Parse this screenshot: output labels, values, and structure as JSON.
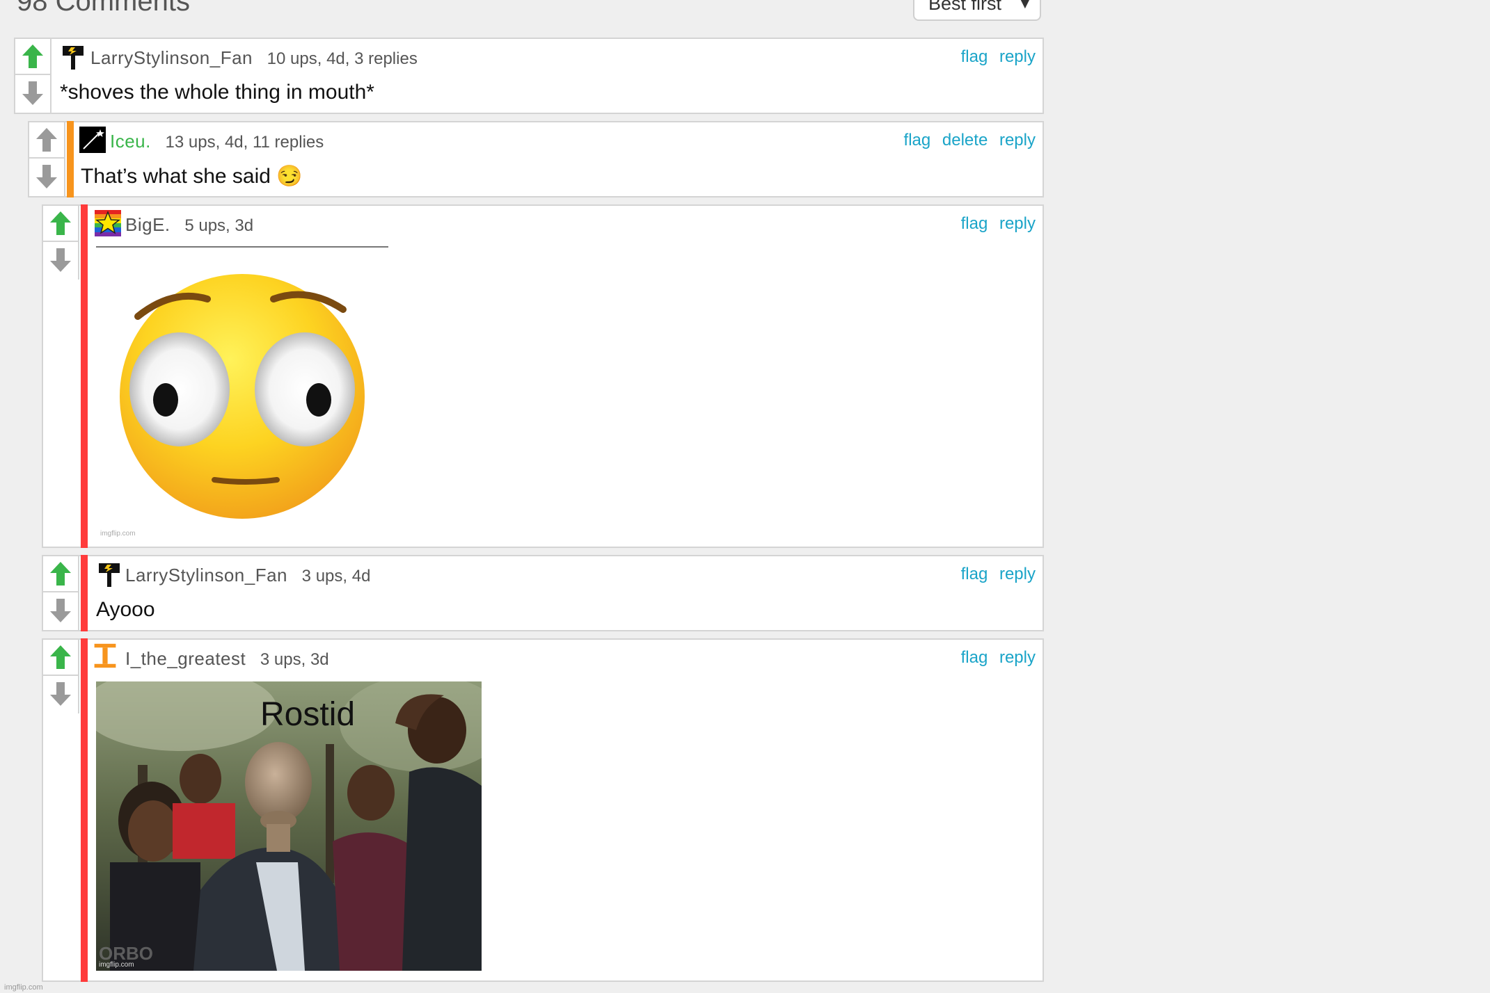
{
  "header": {
    "title": "98 Comments",
    "sort_label": "Best first"
  },
  "comments": [
    {
      "user": "LarryStylinson_Fan",
      "meta": "10 ups, 4d, 3 replies",
      "text": "*shoves the whole thing in mouth*",
      "actions": [
        "flag",
        "reply"
      ]
    },
    {
      "user": "Iceu.",
      "meta": "13 ups, 4d, 11 replies",
      "text": "That’s what she said 😏",
      "actions": [
        "flag",
        "delete",
        "reply"
      ],
      "bar_color": "#f7941d"
    },
    {
      "user": "BigE.",
      "meta": "5 ups, 3d",
      "actions": [
        "flag",
        "reply"
      ],
      "image_watermark": "imgflip.com",
      "bar_color": "#ff3b3b"
    },
    {
      "user": "LarryStylinson_Fan",
      "meta": "3 ups, 4d",
      "text": "Ayooo",
      "actions": [
        "flag",
        "reply"
      ],
      "bar_color": "#ff3b3b"
    },
    {
      "user": "I_the_greatest",
      "meta": "3 ups, 3d",
      "actions": [
        "flag",
        "reply"
      ],
      "image_caption": "Rostid",
      "image_watermark": "imgflip.com",
      "image_logo": "ORBO",
      "bar_color": "#ff3b3b"
    }
  ],
  "page_watermark": "imgflip.com",
  "colors": {
    "upvote_active": "#3ab54a",
    "vote_inactive": "#9a9a9a",
    "link": "#1aa4c8",
    "orange_bar": "#f7941d",
    "red_bar": "#ff3b3b"
  }
}
